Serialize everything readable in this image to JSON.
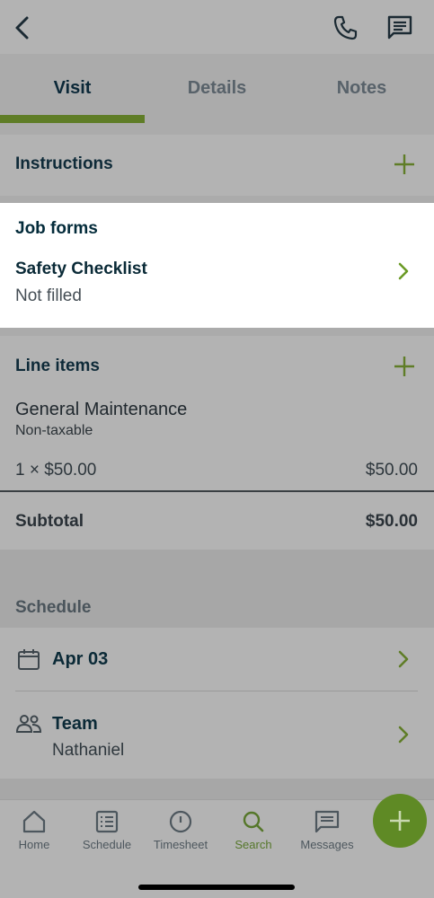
{
  "header": {
    "back_icon": "chevron-left-icon",
    "phone_icon": "phone-icon",
    "message_icon": "message-icon"
  },
  "tabs": [
    {
      "label": "Visit",
      "active": true
    },
    {
      "label": "Details",
      "active": false
    },
    {
      "label": "Notes",
      "active": false
    }
  ],
  "instructions": {
    "title": "Instructions",
    "add_icon": "plus-icon"
  },
  "job_forms": {
    "title": "Job forms",
    "form_name": "Safety Checklist",
    "form_status": "Not filled"
  },
  "line_items": {
    "title": "Line items",
    "item_name": "General Maintenance",
    "item_tax": "Non-taxable",
    "item_qty_price": "1 × $50.00",
    "item_total": "$50.00",
    "subtotal_label": "Subtotal",
    "subtotal_value": "$50.00"
  },
  "schedule": {
    "label": "Schedule",
    "date": "Apr 03",
    "team_label": "Team",
    "team_member": "Nathaniel"
  },
  "bottom_nav": [
    {
      "label": "Home",
      "icon": "home-icon"
    },
    {
      "label": "Schedule",
      "icon": "list-icon"
    },
    {
      "label": "Timesheet",
      "icon": "clock-icon"
    },
    {
      "label": "Search",
      "icon": "search-icon",
      "active": true
    },
    {
      "label": "Messages",
      "icon": "message-icon"
    }
  ],
  "colors": {
    "accent": "#5f8a25",
    "text": "#0e2a38",
    "overlay": "#ababab"
  }
}
